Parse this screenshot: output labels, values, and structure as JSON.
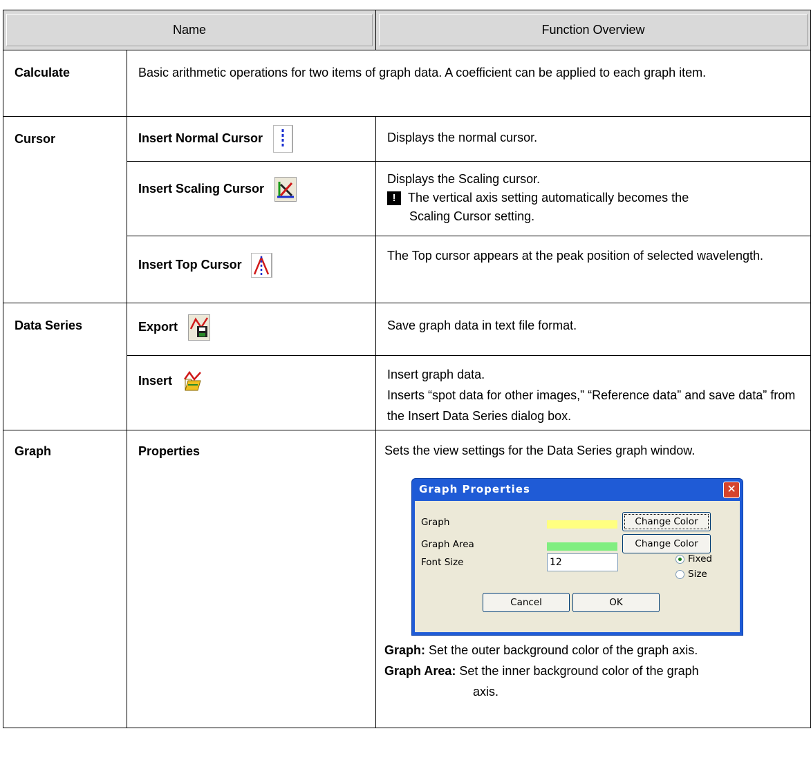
{
  "header": {
    "name": "Name",
    "function": "Function Overview"
  },
  "rows": {
    "calculate": {
      "name": "Calculate",
      "desc": "Basic arithmetic operations for two items of graph data. A coefficient can be applied to each graph item."
    },
    "cursor": {
      "name": "Cursor",
      "normal": {
        "label": "Insert Normal Cursor",
        "desc": "Displays the normal cursor.",
        "icon": "normal-cursor-icon"
      },
      "scaling": {
        "label": "Insert Scaling Cursor",
        "desc": "Displays the Scaling cursor.",
        "note_mark": "!",
        "note": "The vertical axis setting automatically becomes the",
        "note2": "Scaling Cursor setting.",
        "icon": "scaling-cursor-icon"
      },
      "top": {
        "label": "Insert Top Cursor",
        "desc": "The Top cursor appears at the peak position of selected wavelength.",
        "icon": "top-cursor-icon"
      }
    },
    "data_series": {
      "name": "Data Series",
      "export": {
        "label": "Export",
        "desc": "Save graph data in text file format.",
        "icon": "export-icon"
      },
      "insert": {
        "label": "Insert",
        "desc1": "Insert graph data.",
        "desc2": "Inserts “spot data for other images,” “Reference data” and save data” from the Insert Data Series dialog box.",
        "icon": "insert-icon"
      }
    },
    "graph": {
      "name": "Graph",
      "properties": {
        "label": "Properties",
        "desc": "Sets the view settings for the Data Series graph window.",
        "graph_term": "Graph:",
        "graph_def": "Set the outer background color of the graph axis.",
        "area_term": "Graph Area:",
        "area_def": "Set the inner background color of the graph",
        "area_def2": "axis."
      }
    }
  },
  "dialog": {
    "title": "Graph Properties",
    "close": "✕",
    "graph_label": "Graph",
    "area_label": "Graph Area",
    "font_label": "Font Size",
    "change1": "Change Color",
    "change2": "Change Color",
    "font_value": "12",
    "radio_fixed": "Fixed",
    "radio_size": "Size",
    "cancel": "Cancel",
    "ok": "OK",
    "colors": {
      "graph": "#ffff80",
      "area": "#80ee80",
      "titlebar": "#1f5bd6"
    }
  }
}
